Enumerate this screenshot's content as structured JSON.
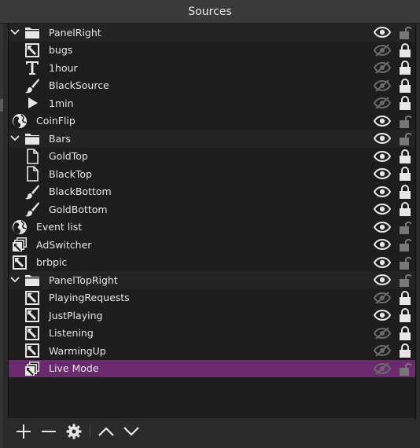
{
  "panel": {
    "title": "Sources"
  },
  "colors": {
    "selected": "#6b2a6e",
    "visible": "#e6e6e6",
    "hidden": "#6a6a6a",
    "locked": "#e6e6e6",
    "unlocked": "#777777"
  },
  "sources": [
    {
      "name": "PanelRight",
      "icon": "folder-icon",
      "depth": 0,
      "folder": true,
      "expanded": true,
      "visible": true,
      "locked": false
    },
    {
      "name": "bugs",
      "icon": "image-icon",
      "depth": 1,
      "visible": false,
      "locked": true
    },
    {
      "name": "1hour",
      "icon": "text-icon",
      "depth": 1,
      "visible": false,
      "locked": true
    },
    {
      "name": "BlackSource",
      "icon": "brush-icon",
      "depth": 1,
      "visible": false,
      "locked": true
    },
    {
      "name": "1min",
      "icon": "play-icon",
      "depth": 1,
      "visible": false,
      "locked": true
    },
    {
      "name": "CoinFlip",
      "icon": "globe-icon",
      "depth": 0,
      "visible": true,
      "locked": false
    },
    {
      "name": "Bars",
      "icon": "folder-icon",
      "depth": 0,
      "folder": true,
      "expanded": true,
      "visible": true,
      "locked": false
    },
    {
      "name": "GoldTop",
      "icon": "file-icon",
      "depth": 1,
      "visible": true,
      "locked": true
    },
    {
      "name": "BlackTop",
      "icon": "file-icon",
      "depth": 1,
      "visible": true,
      "locked": true
    },
    {
      "name": "BlackBottom",
      "icon": "brush-icon",
      "depth": 1,
      "visible": true,
      "locked": true
    },
    {
      "name": "GoldBottom",
      "icon": "brush-icon",
      "depth": 1,
      "visible": true,
      "locked": true
    },
    {
      "name": "Event list",
      "icon": "globe-icon",
      "depth": 0,
      "visible": true,
      "locked": false
    },
    {
      "name": "AdSwitcher",
      "icon": "slideshow-icon",
      "depth": 0,
      "visible": true,
      "locked": false
    },
    {
      "name": "brbpic",
      "icon": "image-icon",
      "depth": 0,
      "visible": true,
      "locked": false
    },
    {
      "name": "PanelTopRight",
      "icon": "folder-icon",
      "depth": 0,
      "folder": true,
      "expanded": true,
      "visible": true,
      "locked": false
    },
    {
      "name": "PlayingRequests",
      "icon": "image-icon",
      "depth": 1,
      "visible": false,
      "locked": true
    },
    {
      "name": "JustPlaying",
      "icon": "image-icon",
      "depth": 1,
      "visible": true,
      "locked": true
    },
    {
      "name": "Listening",
      "icon": "image-icon",
      "depth": 1,
      "visible": false,
      "locked": true
    },
    {
      "name": "WarmingUp",
      "icon": "image-icon",
      "depth": 1,
      "visible": false,
      "locked": true
    },
    {
      "name": "Live Mode",
      "icon": "slideshow-icon",
      "depth": 1,
      "visible": false,
      "locked": false,
      "selected": true
    }
  ],
  "toolbar": [
    {
      "icon": "plus-icon"
    },
    {
      "icon": "minus-icon"
    },
    {
      "icon": "gear-icon"
    },
    {
      "icon": "chevron-up-icon"
    },
    {
      "icon": "chevron-down-icon"
    }
  ]
}
